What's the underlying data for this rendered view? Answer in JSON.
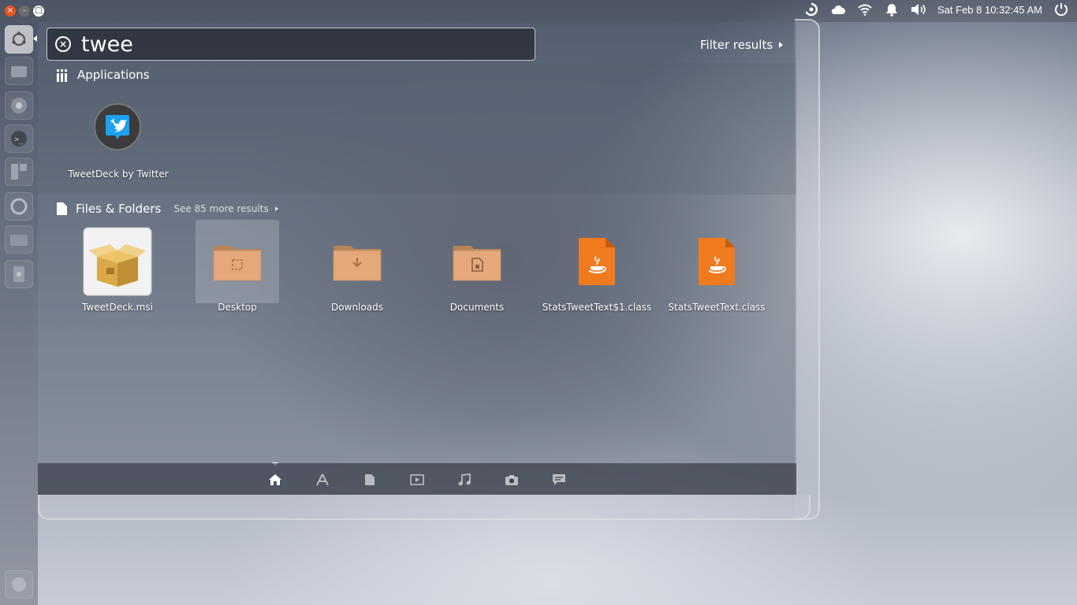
{
  "window_controls": {
    "close": "×",
    "minimize": "–",
    "maximize": "□"
  },
  "panel": {
    "indicators": [
      "ubuntu-one-icon",
      "cloud-icon",
      "wifi-icon",
      "notification-bell-icon",
      "volume-icon"
    ],
    "clock": "Sat Feb  8  10:32:45 AM"
  },
  "launcher": {
    "items": [
      "dash-home-icon",
      "files-icon",
      "chromium-icon",
      "terminal-icon",
      "workspaces-icon",
      "ubuntu-one-icon",
      "folder-icon",
      "device-icon",
      "trash-icon"
    ]
  },
  "search": {
    "value": "twee",
    "clear_icon": "clear-icon"
  },
  "filter": {
    "label": "Filter results"
  },
  "categories": {
    "applications": {
      "title": "Applications",
      "items": [
        {
          "label": "TweetDeck by Twitter",
          "icon": "tweetdeck-icon"
        }
      ]
    },
    "files": {
      "title": "Files & Folders",
      "more": "See 85 more results",
      "items": [
        {
          "label": "TweetDeck.msi",
          "icon": "package-icon"
        },
        {
          "label": "Desktop",
          "icon": "desktop-folder-icon"
        },
        {
          "label": "Downloads",
          "icon": "downloads-folder-icon"
        },
        {
          "label": "Documents",
          "icon": "documents-folder-icon"
        },
        {
          "label": "StatsTweetText$1.class",
          "icon": "java-class-icon"
        },
        {
          "label": "StatsTweetText.class",
          "icon": "java-class-icon"
        }
      ]
    }
  },
  "lenses": [
    "home-lens",
    "applications-lens",
    "files-lens",
    "video-lens",
    "music-lens",
    "photo-lens",
    "social-lens"
  ],
  "colors": {
    "folder": "#e4a87a",
    "java_file": "#f07b1e",
    "close_button": "#e9541f",
    "tweetdeck_blue": "#1da1f2"
  }
}
